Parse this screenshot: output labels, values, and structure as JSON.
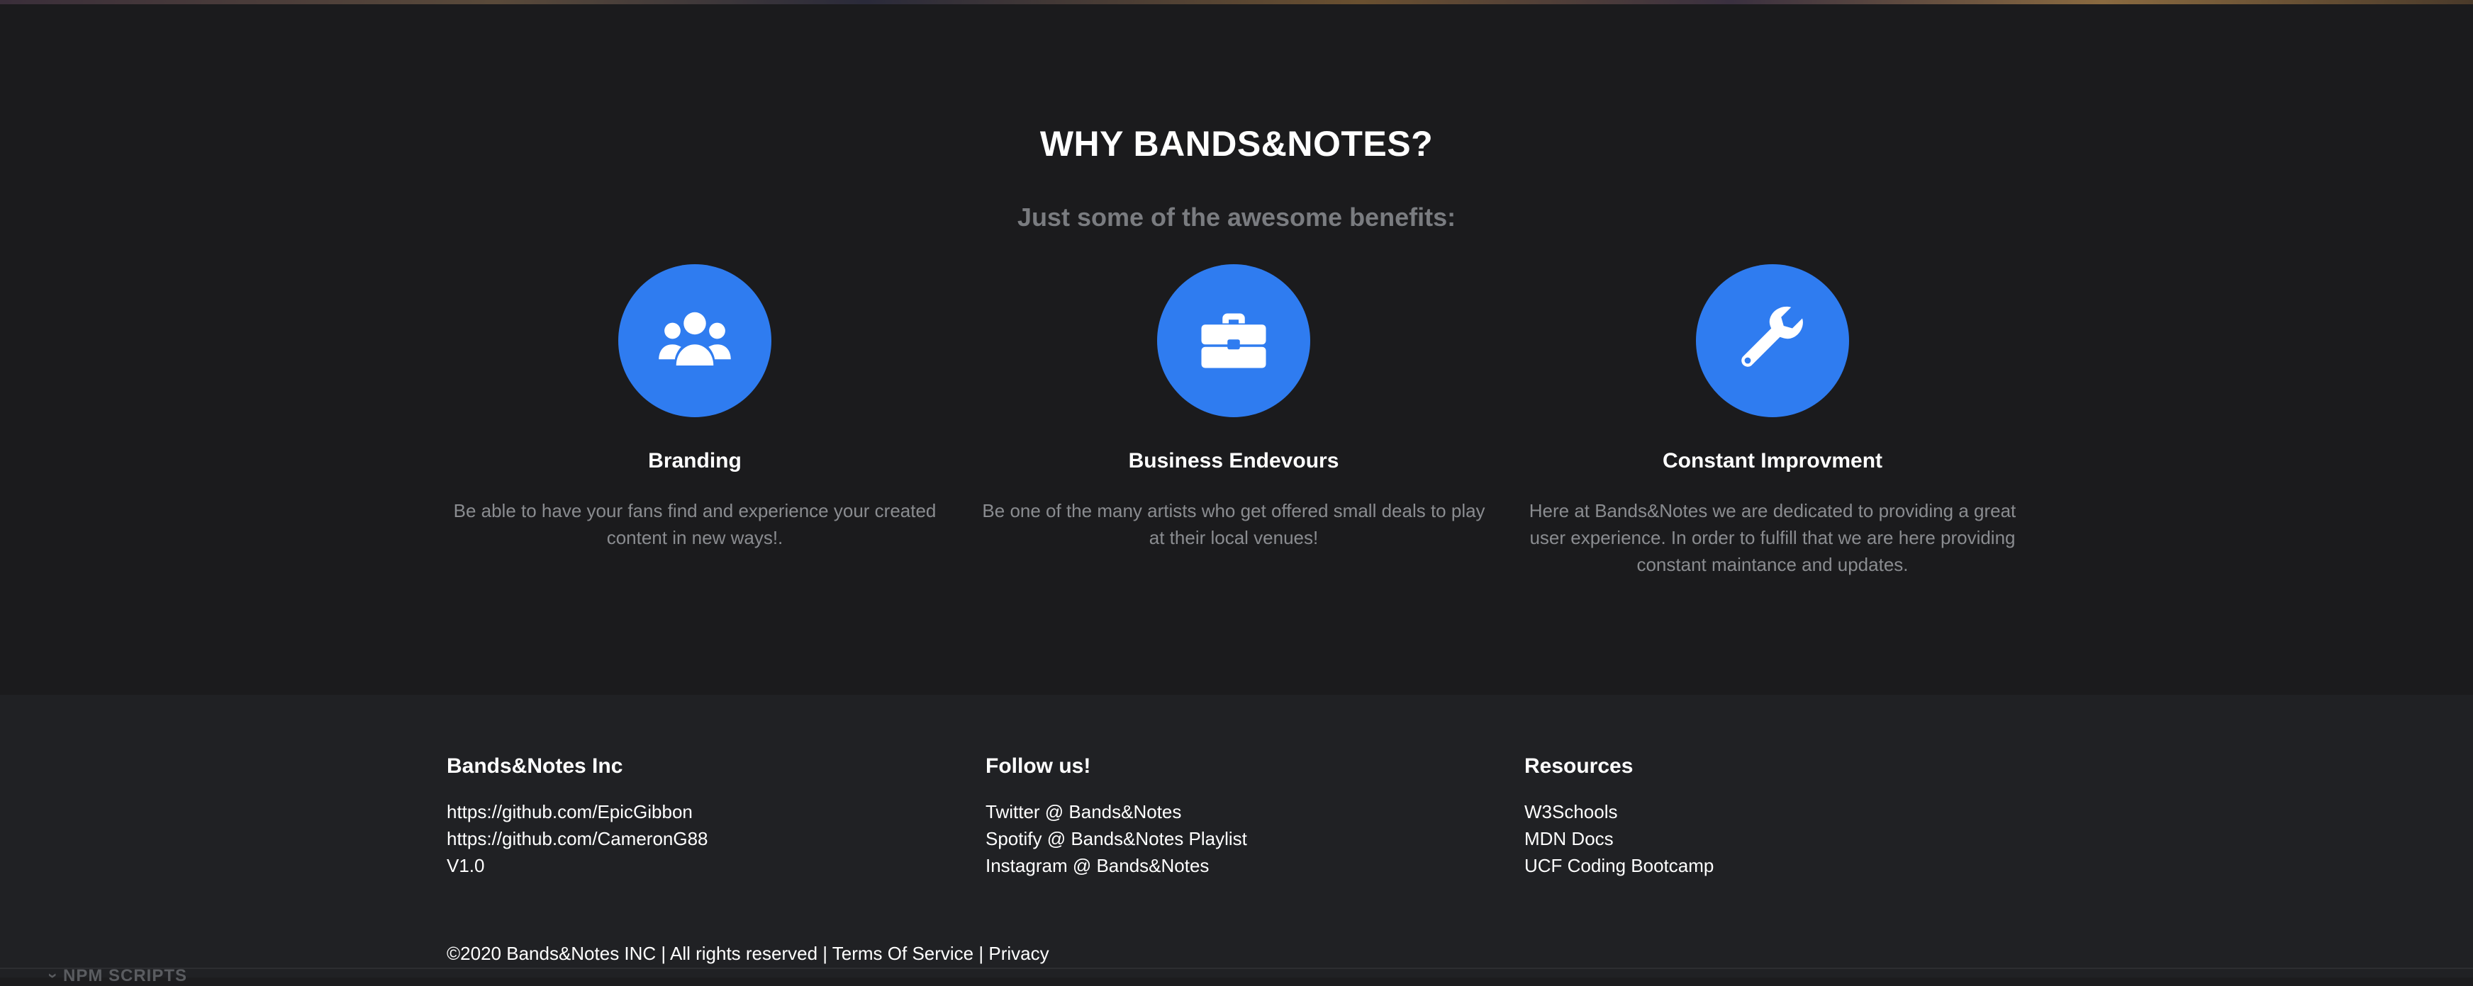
{
  "features": {
    "title": "WHY BANDS&NOTES?",
    "subtitle": "Just some of the awesome benefits:",
    "items": [
      {
        "icon": "users-icon",
        "title": "Branding",
        "desc": "Be able to have your fans find and experience your created content in new ways!."
      },
      {
        "icon": "briefcase-icon",
        "title": "Business Endevours",
        "desc": "Be one of the many artists who get offered small deals to play at their local venues!"
      },
      {
        "icon": "wrench-icon",
        "title": "Constant Improvment",
        "desc": "Here at Bands&Notes we are dedicated to providing a great user experience. In order to fulfill that we are here providing constant maintance and updates."
      }
    ],
    "accent_color": "#2f7cf0"
  },
  "footer": {
    "columns": [
      {
        "heading": "Bands&Notes Inc",
        "links": [
          "https://github.com/EpicGibbon",
          "https://github.com/CameronG88",
          "V1.0"
        ]
      },
      {
        "heading": "Follow us!",
        "links": [
          "Twitter @ Bands&Notes",
          "Spotify @ Bands&Notes Playlist",
          "Instagram @ Bands&Notes"
        ]
      },
      {
        "heading": "Resources",
        "links": [
          "W3Schools",
          "MDN Docs",
          "UCF Coding Bootcamp"
        ]
      }
    ],
    "copyright": "©2020 Bands&Notes INC | All rights reserved | Terms Of Service | Privacy"
  },
  "ide_overlay": {
    "label": "NPM SCRIPTS",
    "caret_icon": "chevron-right-icon"
  }
}
